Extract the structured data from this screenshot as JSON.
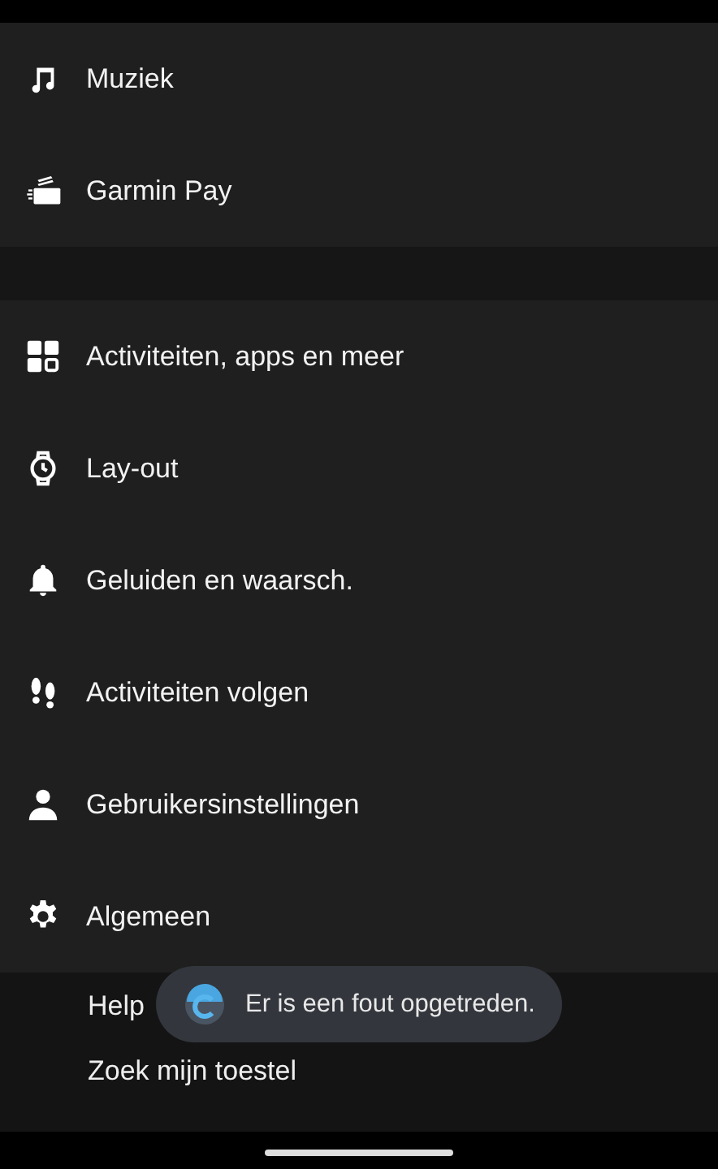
{
  "sections": [
    {
      "items": [
        {
          "label": "Muziek",
          "kind": "music"
        },
        {
          "label": "Garmin Pay",
          "kind": "card"
        }
      ]
    },
    {
      "items": [
        {
          "label": "Activiteiten, apps en meer",
          "kind": "grid"
        },
        {
          "label": "Lay-out",
          "kind": "watch"
        },
        {
          "label": "Geluiden en waarsch.",
          "kind": "bell"
        },
        {
          "label": "Activiteiten volgen",
          "kind": "footsteps"
        },
        {
          "label": "Gebruikersinstellingen",
          "kind": "person"
        },
        {
          "label": "Algemeen",
          "kind": "gear"
        }
      ]
    }
  ],
  "links": [
    "Help",
    "Zoek mijn toestel"
  ],
  "toast": {
    "message": "Er is een fout opgetreden."
  }
}
